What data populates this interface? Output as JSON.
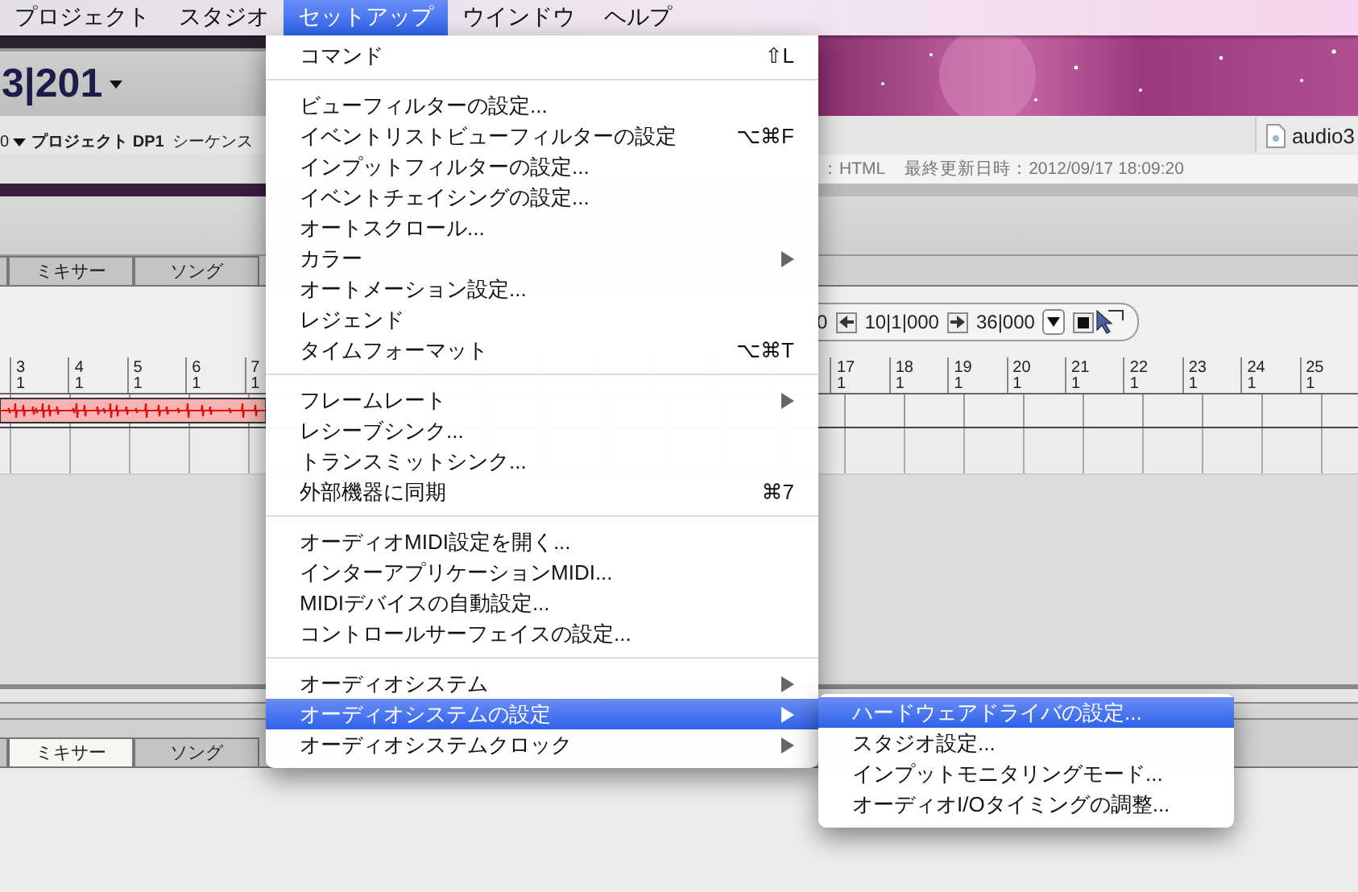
{
  "menubar": {
    "items": [
      {
        "label": "プロジェクト",
        "selected": false
      },
      {
        "label": "スタジオ",
        "selected": false
      },
      {
        "label": "セットアップ",
        "selected": true
      },
      {
        "label": "ウインドウ",
        "selected": false
      },
      {
        "label": "ヘルプ",
        "selected": false
      }
    ]
  },
  "app": {
    "counter": "3|201",
    "project_bar": {
      "value": "0",
      "project": "プロジェクト DP1",
      "sequence": "シーケンス"
    },
    "document_tab": "audio3",
    "file_info": {
      "format": "：HTML",
      "modified": "最終更新日時：2012/09/17 18:09:20"
    },
    "tabs_top": [
      {
        "label": "ミキサー",
        "selected": false
      },
      {
        "label": "ソング",
        "selected": false
      }
    ],
    "transport": {
      "start": "0",
      "current": "10|1|000",
      "end": "36|000"
    },
    "ruler_left": [
      {
        "bar": "3",
        "beat": "1"
      },
      {
        "bar": "4",
        "beat": "1"
      },
      {
        "bar": "5",
        "beat": "1"
      },
      {
        "bar": "6",
        "beat": "1"
      },
      {
        "bar": "7",
        "beat": "1"
      }
    ],
    "ruler_right": [
      {
        "bar": "17",
        "beat": "1"
      },
      {
        "bar": "18",
        "beat": "1"
      },
      {
        "bar": "19",
        "beat": "1"
      },
      {
        "bar": "20",
        "beat": "1"
      },
      {
        "bar": "21",
        "beat": "1"
      },
      {
        "bar": "22",
        "beat": "1"
      },
      {
        "bar": "23",
        "beat": "1"
      },
      {
        "bar": "24",
        "beat": "1"
      },
      {
        "bar": "25",
        "beat": "1"
      }
    ],
    "tabs_bottom": [
      {
        "label": "ミキサー",
        "selected": true
      },
      {
        "label": "ソング",
        "selected": false
      }
    ]
  },
  "menu": {
    "items": [
      {
        "kind": "item",
        "label": "コマンド",
        "shortcut": "⇧L",
        "submenu": false,
        "selected": false
      },
      {
        "kind": "separator"
      },
      {
        "kind": "item",
        "label": "ビューフィルターの設定...",
        "submenu": false,
        "selected": false
      },
      {
        "kind": "item",
        "label": "イベントリストビューフィルターの設定",
        "shortcut": "⌥⌘F",
        "submenu": false,
        "selected": false
      },
      {
        "kind": "item",
        "label": "インプットフィルターの設定...",
        "submenu": false,
        "selected": false
      },
      {
        "kind": "item",
        "label": "イベントチェイシングの設定...",
        "submenu": false,
        "selected": false
      },
      {
        "kind": "item",
        "label": "オートスクロール...",
        "submenu": false,
        "selected": false
      },
      {
        "kind": "item",
        "label": "カラー",
        "submenu": true,
        "selected": false
      },
      {
        "kind": "item",
        "label": "オートメーション設定...",
        "submenu": false,
        "selected": false
      },
      {
        "kind": "item",
        "label": "レジェンド",
        "submenu": false,
        "selected": false
      },
      {
        "kind": "item",
        "label": "タイムフォーマット",
        "shortcut": "⌥⌘T",
        "submenu": false,
        "selected": false
      },
      {
        "kind": "separator"
      },
      {
        "kind": "item",
        "label": "フレームレート",
        "submenu": true,
        "selected": false
      },
      {
        "kind": "item",
        "label": "レシーブシンク...",
        "submenu": false,
        "selected": false
      },
      {
        "kind": "item",
        "label": "トランスミットシンク...",
        "submenu": false,
        "selected": false
      },
      {
        "kind": "item",
        "label": "外部機器に同期",
        "shortcut": "⌘7",
        "submenu": false,
        "selected": false
      },
      {
        "kind": "separator"
      },
      {
        "kind": "item",
        "label": "オーディオMIDI設定を開く...",
        "submenu": false,
        "selected": false
      },
      {
        "kind": "item",
        "label": "インターアプリケーションMIDI...",
        "submenu": false,
        "selected": false
      },
      {
        "kind": "item",
        "label": "MIDIデバイスの自動設定...",
        "submenu": false,
        "selected": false
      },
      {
        "kind": "item",
        "label": "コントロールサーフェイスの設定...",
        "submenu": false,
        "selected": false
      },
      {
        "kind": "separator"
      },
      {
        "kind": "item",
        "label": "オーディオシステム",
        "submenu": true,
        "selected": false
      },
      {
        "kind": "item",
        "label": "オーディオシステムの設定",
        "submenu": true,
        "selected": true
      },
      {
        "kind": "item",
        "label": "オーディオシステムクロック",
        "submenu": true,
        "selected": false
      }
    ]
  },
  "submenu": {
    "items": [
      {
        "kind": "item",
        "label": "ハードウェアドライバの設定...",
        "submenu": false,
        "selected": true
      },
      {
        "kind": "item",
        "label": "スタジオ設定...",
        "submenu": false,
        "selected": false
      },
      {
        "kind": "item",
        "label": "インプットモニタリングモード...",
        "submenu": false,
        "selected": false
      },
      {
        "kind": "item",
        "label": "オーディオI/Oタイミングの調整...",
        "submenu": false,
        "selected": false
      }
    ]
  }
}
